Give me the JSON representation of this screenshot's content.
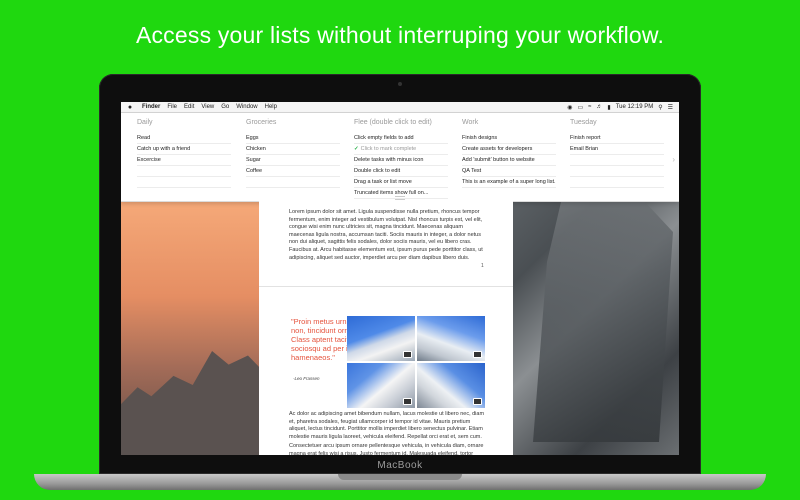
{
  "headline": "Access your lists without interruping your workflow.",
  "laptop_brand": "MacBook",
  "menubar": {
    "apple": "",
    "items": [
      "Finder",
      "File",
      "Edit",
      "View",
      "Go",
      "Window",
      "Help"
    ],
    "clock": "Tue 12:19 PM",
    "icons": [
      "app-status-icon",
      "airplay-icon",
      "wifi-icon",
      "volume-icon",
      "battery-icon",
      "search-icon",
      "list-icon"
    ]
  },
  "lists": [
    {
      "title": "Daily",
      "items": [
        "Read",
        "Catch up with a friend",
        "Excercise"
      ]
    },
    {
      "title": "Groceries",
      "items": [
        "Eggs",
        "Chicken",
        "Sugar",
        "Coffee"
      ]
    },
    {
      "title": "Flee (double click to edit)",
      "items": [
        {
          "text": "Click empty fields to add",
          "done": false
        },
        {
          "text": "Click to mark complete",
          "done": true
        },
        {
          "text": "Delete tasks with minus icon",
          "done": false
        },
        {
          "text": "Double click to edit",
          "done": false
        },
        {
          "text": "Drag a task or list move",
          "done": false
        },
        {
          "text": "Truncated items show full on...",
          "done": false
        }
      ]
    },
    {
      "title": "Work",
      "items": [
        "Finish designs",
        "Create assets for developers",
        "Add 'submit' button to website",
        "QA Test",
        "This is an example of a super long list..."
      ]
    },
    {
      "title": "Tuesday",
      "items": [
        "Finish report",
        "Email Brian"
      ]
    }
  ],
  "document": {
    "paragraph_1": "Lorem ipsum dolor sit amet. Ligula suspendisse nulla pretium, rhoncus tempor fermentum, enim integer ad vestibulum volutpat. Nisl rhoncus turpis est, vel elit, congue wisi enim nunc ultricies sit, magna tincidunt. Maecenas aliquam maecenas ligula nostra, accumsan taciti. Sociis mauris in integer, a dolor netus non dui aliquet, sagittis felis sodales, dolor sociis mauris, vel eu libero cras. Faucibus at. Arcu habitasse elementum est, ipsum purus pede porttitor class, ut adipiscing, aliquet sed auctor, imperdiet arcu per diam dapibus libero duis.",
    "page_number": "1",
    "quote": "\"Proin metus urna porta non, tincidunt ornare. Class aptent taciti sociosqu ad per inceptos hamenaeos.\"",
    "quote_author": "-Leo Frassen",
    "paragraph_2": "Ac dolor ac adipiscing amet bibendum nullam, lacus molestie ut libero nec, diam et, pharetra sodales, feugiat ullamcorper id tempor id vitae. Mauris pretium aliquet, lectus tincidunt. Porttitor mollis imperdiet libero senectus pulvinar. Etiam molestie mauris ligula laoreet, vehicula eleifend. Repellat orci erat et, sem cum.",
    "paragraph_3": "Consectetuer arcu ipsum ornare pellentesque vehicula, in vehicula diam, ornare magna erat felis wisi a risus. Justo fermentum id. Malesuada eleifend, tortor molestie, a fusce a vel et. Mauris at suspendisse, neque aliquam faucibus adipiscing, vivamus in. Wisi mattis leo suscipit nec amet, nisl fermentum tempor ac a, augue in eleifend in venenatis, cras sit id in vestibulum felis in, sed ligula."
  }
}
